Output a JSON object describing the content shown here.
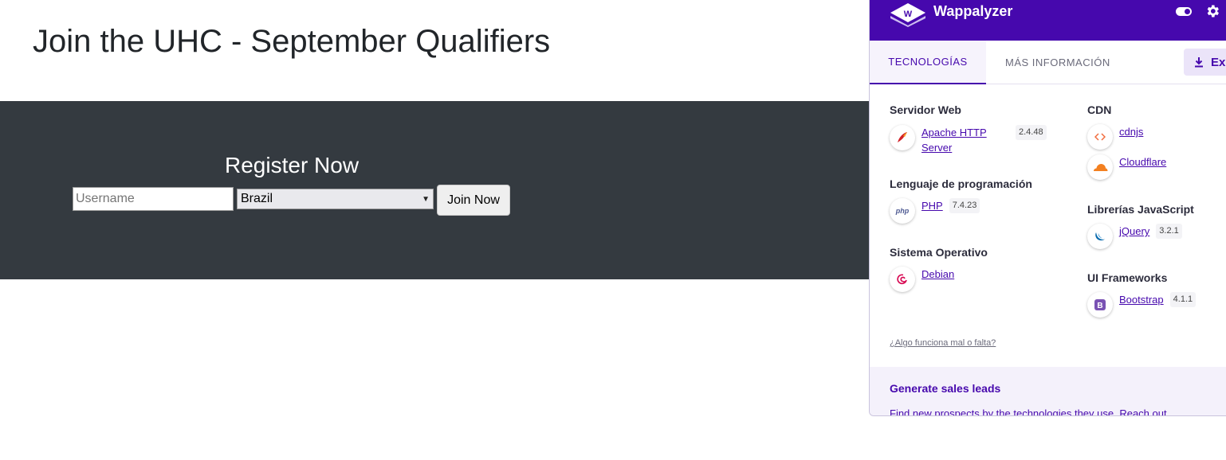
{
  "page": {
    "title": "Join the UHC - September Qualifiers",
    "register_heading": "Register Now",
    "username_placeholder": "Username",
    "country_selected": "Brazil",
    "join_button": "Join Now"
  },
  "wappalyzer": {
    "title": "Wappalyzer",
    "tabs": {
      "technologies": "TECNOLOGÍAS",
      "more_info": "MÁS INFORMACIÓN"
    },
    "export_label": "Exp",
    "categories": {
      "web_server": {
        "title": "Servidor Web",
        "name": "Apache HTTP Server",
        "name_line1": "Apache HTTP",
        "name_line2": "Server",
        "version": "2.4.48"
      },
      "programming": {
        "title": "Lenguaje de programación",
        "name": "PHP",
        "version": "7.4.23"
      },
      "os": {
        "title": "Sistema Operativo",
        "name": "Debian"
      },
      "cdn": {
        "title": "CDN",
        "items": [
          {
            "name": "cdnjs"
          },
          {
            "name": "Cloudflare"
          }
        ]
      },
      "js_libs": {
        "title": "Librerías JavaScript",
        "name": "jQuery",
        "version": "3.2.1"
      },
      "ui_frameworks": {
        "title": "UI Frameworks",
        "name": "Bootstrap",
        "version": "4.1.1"
      }
    },
    "wrong_link": "¿Algo funciona mal o falta?",
    "promo_title": "Generate sales leads",
    "promo_text": "Find new prospects by the technologies they use. Reach out",
    "colors": {
      "brand": "#4608ad",
      "hero": "#343a40"
    },
    "icons": [
      "wappalyzer-logo",
      "toggle-icon",
      "gear-icon",
      "download-icon",
      "apache-icon",
      "php-icon",
      "debian-icon",
      "cdnjs-icon",
      "cloudflare-icon",
      "jquery-icon",
      "bootstrap-icon"
    ]
  }
}
